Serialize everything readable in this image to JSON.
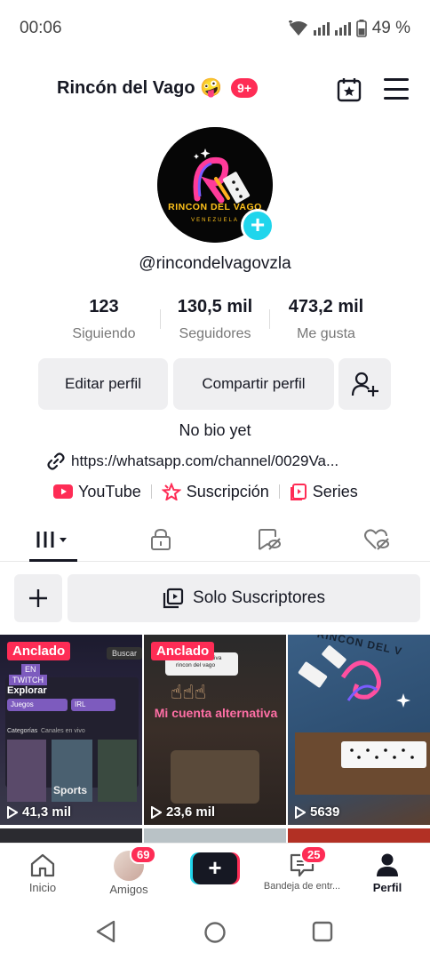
{
  "status": {
    "time": "00:06",
    "battery": "49 %"
  },
  "header": {
    "title": "Rincón del Vago 🤪",
    "notif_badge": "9+"
  },
  "profile": {
    "logo_text": "RINCON DEL VAGO",
    "logo_sub": "VENEZUELA",
    "username": "@rincondelvagovzla",
    "stats": [
      {
        "value": "123",
        "label": "Siguiendo"
      },
      {
        "value": "130,5 mil",
        "label": "Seguidores"
      },
      {
        "value": "473,2 mil",
        "label": "Me gusta"
      }
    ],
    "edit_label": "Editar perfil",
    "share_label": "Compartir perfil",
    "bio": "No bio yet",
    "link": "https://whatsapp.com/channel/0029Va...",
    "links": [
      {
        "label": "YouTube",
        "icon": "youtube-icon"
      },
      {
        "label": "Suscripción",
        "icon": "subscription-icon"
      },
      {
        "label": "Series",
        "icon": "series-icon"
      }
    ]
  },
  "subscribers_label": "Solo Suscriptores",
  "videos": [
    {
      "pinned": "Anclado",
      "views": "41,3 mil",
      "overlay_en": "EN",
      "overlay_twitch": "TWITCH",
      "overlay_explorar": "Explorar",
      "overlay_buscar": "Buscar",
      "overlay_juegos": "Juegos",
      "overlay_irl": "IRL",
      "overlay_categorias": "Categorías",
      "overlay_canales": "Canales en vivo",
      "overlay_sports": "Sports"
    },
    {
      "pinned": "Anclado",
      "views": "23,6 mil",
      "overlay_note": "cuenta alternativa rincon del vago",
      "overlay_caption": "Mi cuenta alternativa"
    },
    {
      "pinned": "",
      "views": "5639",
      "overlay_rincon": "RINCON DEL V"
    }
  ],
  "nav": {
    "home": "Inicio",
    "friends": "Amigos",
    "friends_badge": "69",
    "inbox": "Bandeja de entr...",
    "inbox_badge": "25",
    "profile": "Perfil"
  },
  "colors": {
    "accent": "#fe2c55",
    "cyan": "#20d5ec"
  }
}
